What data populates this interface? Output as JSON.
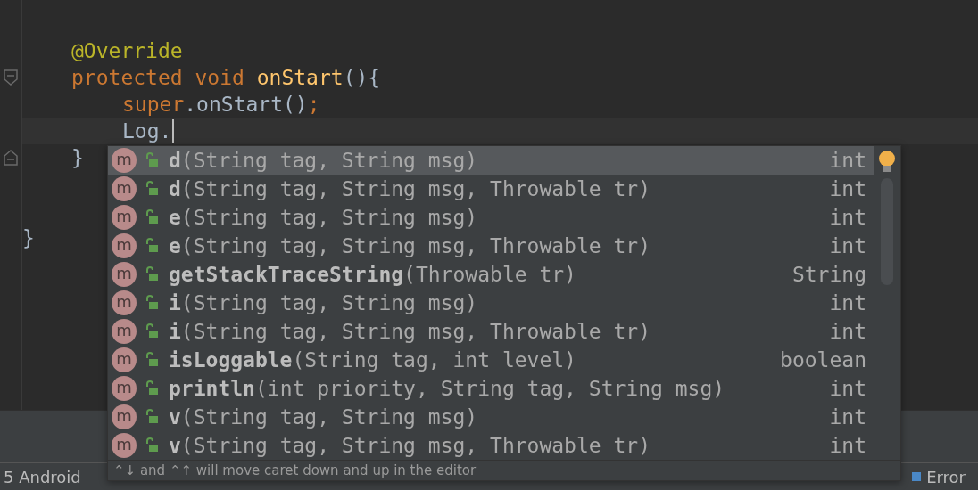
{
  "editor": {
    "lines": [
      {
        "kind": "blank"
      },
      {
        "kind": "member",
        "tokens": [
          {
            "kind": "annotation",
            "text": "@Override"
          }
        ]
      },
      {
        "kind": "member",
        "fold_marker": {
          "kind": "start"
        },
        "tokens": [
          {
            "kind": "keyword",
            "text": "protected void "
          },
          {
            "kind": "method",
            "text": "onStart"
          },
          {
            "kind": "plain",
            "text": "(){"
          }
        ]
      },
      {
        "kind": "statement",
        "tokens": [
          {
            "kind": "keyword",
            "text": "super"
          },
          {
            "kind": "plain",
            "text": ".onStart()"
          },
          {
            "kind": "keyword",
            "text": ";"
          }
        ]
      },
      {
        "kind": "statement",
        "current": true,
        "tokens": [
          {
            "kind": "plain",
            "text": "Log."
          }
        ]
      },
      {
        "kind": "member",
        "fold_marker": {
          "kind": "end"
        },
        "tokens": [
          {
            "kind": "plain",
            "text": "}"
          }
        ]
      },
      {
        "kind": "blank"
      },
      {
        "kind": "blank"
      },
      {
        "kind": "class",
        "tokens": [
          {
            "kind": "plain",
            "text": "}"
          }
        ]
      }
    ]
  },
  "completion": {
    "items": [
      {
        "icon": "m",
        "name": "d",
        "params": "(String tag, String msg)",
        "type": "int",
        "selected": true
      },
      {
        "icon": "m",
        "name": "d",
        "params": "(String tag, String msg, Throwable tr)",
        "type": "int",
        "selected": false
      },
      {
        "icon": "m",
        "name": "e",
        "params": "(String tag, String msg)",
        "type": "int",
        "selected": false
      },
      {
        "icon": "m",
        "name": "e",
        "params": "(String tag, String msg, Throwable tr)",
        "type": "int",
        "selected": false
      },
      {
        "icon": "m",
        "name": "getStackTraceString",
        "params": "(Throwable tr)",
        "type": "String",
        "selected": false
      },
      {
        "icon": "m",
        "name": "i",
        "params": "(String tag, String msg)",
        "type": "int",
        "selected": false
      },
      {
        "icon": "m",
        "name": "i",
        "params": "(String tag, String msg, Throwable tr)",
        "type": "int",
        "selected": false
      },
      {
        "icon": "m",
        "name": "isLoggable",
        "params": "(String tag, int level)",
        "type": "boolean",
        "selected": false
      },
      {
        "icon": "m",
        "name": "println",
        "params": "(int priority, String tag, String msg)",
        "type": "int",
        "selected": false
      },
      {
        "icon": "m",
        "name": "v",
        "params": "(String tag, String msg)",
        "type": "int",
        "selected": false
      },
      {
        "icon": "m",
        "name": "v",
        "params": "(String tag, String msg, Throwable tr)",
        "type": "int",
        "selected": false
      }
    ],
    "footer": "⌃↓ and ⌃↑ will move caret down and up in the editor"
  },
  "status_bar": {
    "left": "5 Android",
    "right": "Error"
  }
}
